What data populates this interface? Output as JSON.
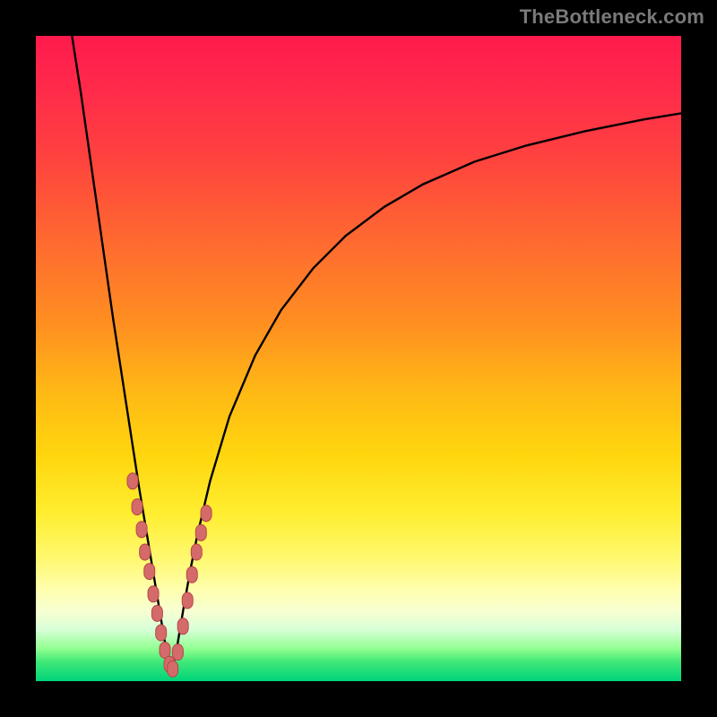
{
  "watermark": {
    "text": "TheBottleneck.com"
  },
  "colors": {
    "background": "#000000",
    "curve": "#000000",
    "marker_fill": "#d46a6a",
    "marker_stroke": "#b54848",
    "gradient_top": "#ff1a4d",
    "gradient_mid": "#ffd60e",
    "gradient_bottom": "#00d47a"
  },
  "chart_data": {
    "type": "line",
    "title": "",
    "xlabel": "",
    "ylabel": "",
    "xlim": [
      0,
      100
    ],
    "ylim": [
      0,
      100
    ],
    "description": "Bottleneck curve: two branches descending from high bottleneck values on either side to a minimum near x≈21 (y≈0). Left branch is steep; right branch is shallower asymptotically approaching high values. Salmon-colored markers cluster near the minimum on both branches.",
    "series": [
      {
        "name": "left-branch",
        "x": [
          5.6,
          7,
          8,
          9,
          10,
          11,
          12,
          13,
          14,
          15,
          16,
          17,
          18,
          19,
          20,
          21
        ],
        "values": [
          100,
          91,
          84,
          77,
          70,
          63,
          56,
          49.5,
          43,
          36.5,
          30,
          24,
          18,
          12,
          6,
          1
        ]
      },
      {
        "name": "right-branch",
        "x": [
          21,
          22,
          23,
          24,
          25,
          27,
          30,
          34,
          38,
          43,
          48,
          54,
          60,
          68,
          76,
          85,
          94,
          100
        ],
        "values": [
          1,
          6,
          12,
          17.5,
          22.5,
          31,
          41,
          50.5,
          57.5,
          64,
          69,
          73.5,
          77,
          80.5,
          83,
          85.2,
          87,
          88
        ]
      },
      {
        "name": "markers",
        "render_as": "scatter",
        "x": [
          15.0,
          15.7,
          16.4,
          16.9,
          17.6,
          18.2,
          18.8,
          19.4,
          20.0,
          20.7,
          21.2,
          22.0,
          22.8,
          23.5,
          24.2,
          24.9,
          25.6,
          26.4
        ],
        "values": [
          31.0,
          27.0,
          23.5,
          20.0,
          17.0,
          13.5,
          10.5,
          7.5,
          4.8,
          2.6,
          1.9,
          4.5,
          8.5,
          12.5,
          16.5,
          20.0,
          23.0,
          26.0
        ]
      }
    ]
  }
}
